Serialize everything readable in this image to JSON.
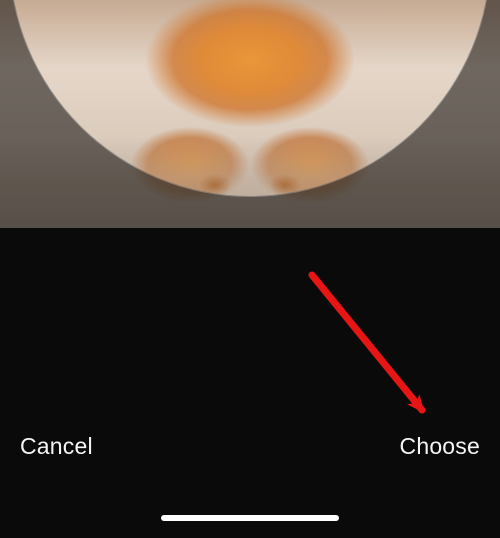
{
  "buttons": {
    "cancel_label": "Cancel",
    "choose_label": "Choose"
  },
  "annotation": {
    "arrow_color": "#e81515",
    "target": "choose-button"
  }
}
